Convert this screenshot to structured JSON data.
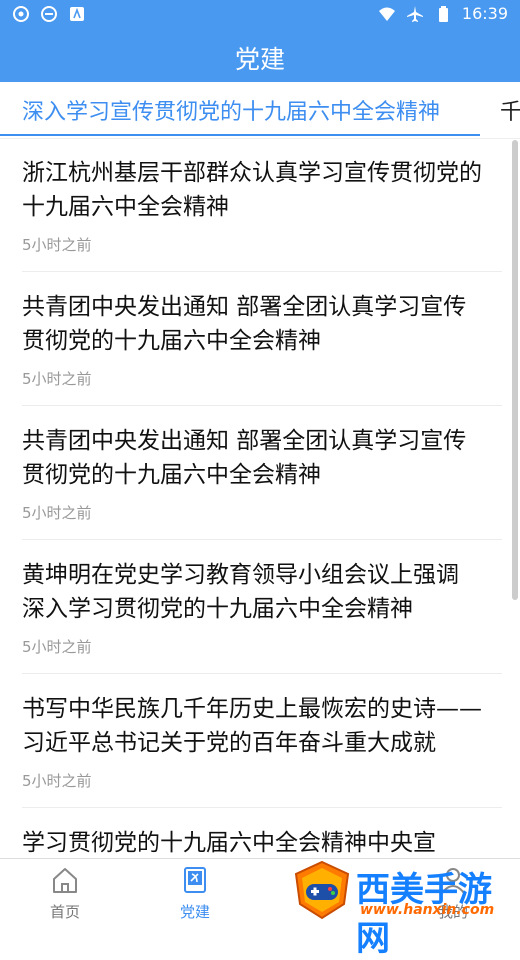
{
  "status_bar": {
    "time": "16:39"
  },
  "app_bar": {
    "title": "党建"
  },
  "tabs": [
    {
      "label": "深入学习宣传贯彻党的十九届六中全会精神"
    },
    {
      "label": "千"
    }
  ],
  "articles": [
    {
      "title": "浙江杭州基层干部群众认真学习宣传贯彻党的十九届六中全会精神",
      "time": "5小时之前"
    },
    {
      "title": "共青团中央发出通知 部署全团认真学习宣传贯彻党的十九届六中全会精神",
      "time": "5小时之前"
    },
    {
      "title": "共青团中央发出通知 部署全团认真学习宣传贯彻党的十九届六中全会精神",
      "time": "5小时之前"
    },
    {
      "title": "黄坤明在党史学习教育领导小组会议上强调 深入学习贯彻党的十九届六中全会精神",
      "time": "5小时之前"
    },
    {
      "title": "书写中华民族几千年历史上最恢宏的史诗——习近平总书记关于党的百年奋斗重大成就",
      "time": "5小时之前"
    },
    {
      "title": "学习贯彻党的十九届六中全会精神中央宣",
      "time": ""
    }
  ],
  "bottom_nav": [
    {
      "label": "首页",
      "icon": "home-icon"
    },
    {
      "label": "党建",
      "icon": "party-book-icon"
    },
    {
      "label": "我的",
      "icon": "user-icon"
    }
  ],
  "watermark": {
    "text": "西美手游网",
    "url": "www.hanxin.com"
  },
  "colors": {
    "primary": "#4a99f0",
    "accent": "#3d8ef0",
    "text": "#111111",
    "muted": "#999999"
  }
}
